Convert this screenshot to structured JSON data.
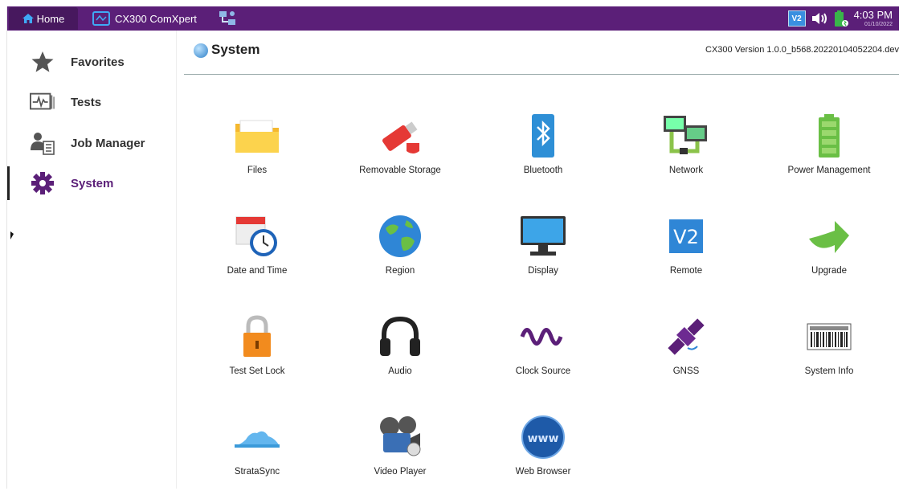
{
  "topbar": {
    "home_label": "Home",
    "app_label": "CX300 ComXpert",
    "vnc_label": "V2",
    "time": "4:03 PM",
    "date": "01/10/2022"
  },
  "sidebar": {
    "items": [
      {
        "label": "Favorites",
        "icon": "star-icon"
      },
      {
        "label": "Tests",
        "icon": "waveform-icon"
      },
      {
        "label": "Job Manager",
        "icon": "job-icon"
      },
      {
        "label": "System",
        "icon": "gear-icon",
        "active": true
      }
    ]
  },
  "main": {
    "title": "System",
    "version": "CX300 Version 1.0.0_b568.20220104052204.dev"
  },
  "tiles": [
    {
      "label": "Files",
      "icon": "folder-icon"
    },
    {
      "label": "Removable Storage",
      "icon": "usb-drive-icon"
    },
    {
      "label": "Bluetooth",
      "icon": "bluetooth-icon"
    },
    {
      "label": "Network",
      "icon": "network-icon"
    },
    {
      "label": "Power Management",
      "icon": "battery-icon"
    },
    {
      "label": "Date and Time",
      "icon": "calendar-clock-icon"
    },
    {
      "label": "Region",
      "icon": "globe-icon"
    },
    {
      "label": "Display",
      "icon": "monitor-icon"
    },
    {
      "label": "Remote",
      "icon": "vnc-icon"
    },
    {
      "label": "Upgrade",
      "icon": "upgrade-arrow-icon"
    },
    {
      "label": "Test Set Lock",
      "icon": "padlock-icon"
    },
    {
      "label": "Audio",
      "icon": "headphones-icon"
    },
    {
      "label": "Clock Source",
      "icon": "sine-wave-icon"
    },
    {
      "label": "GNSS",
      "icon": "satellite-icon"
    },
    {
      "label": "System Info",
      "icon": "barcode-icon"
    },
    {
      "label": "StrataSync",
      "icon": "cloud-icon"
    },
    {
      "label": "Video Player",
      "icon": "film-reel-icon"
    },
    {
      "label": "Web Browser",
      "icon": "www-globe-icon"
    }
  ],
  "colors": {
    "accent": "#5b1f78"
  }
}
